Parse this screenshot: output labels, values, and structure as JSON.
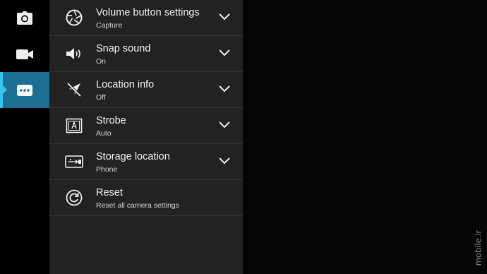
{
  "sidebar": {
    "items": [
      {
        "name": "camera-icon",
        "active": false
      },
      {
        "name": "video-camera-icon",
        "active": false
      },
      {
        "name": "more-options-icon",
        "active": true
      }
    ],
    "accent_color": "#1c6f92",
    "indicator_color": "#38c2f0"
  },
  "settings": {
    "items": [
      {
        "title": "Volume button settings",
        "value": "Capture",
        "icon": "aperture-icon",
        "has_dropdown": true
      },
      {
        "title": "Snap sound",
        "value": "On",
        "icon": "speaker-icon",
        "has_dropdown": true
      },
      {
        "title": "Location info",
        "value": "Off",
        "icon": "location-off-icon",
        "has_dropdown": true
      },
      {
        "title": "Strobe",
        "value": "Auto",
        "icon": "strobe-icon",
        "has_dropdown": true
      },
      {
        "title": "Storage location",
        "value": "Phone",
        "icon": "storage-icon",
        "has_dropdown": true
      },
      {
        "title": "Reset",
        "value": "Reset all camera settings",
        "icon": "reset-icon",
        "has_dropdown": false
      }
    ]
  },
  "watermark": {
    "text": "mobile.ir"
  }
}
